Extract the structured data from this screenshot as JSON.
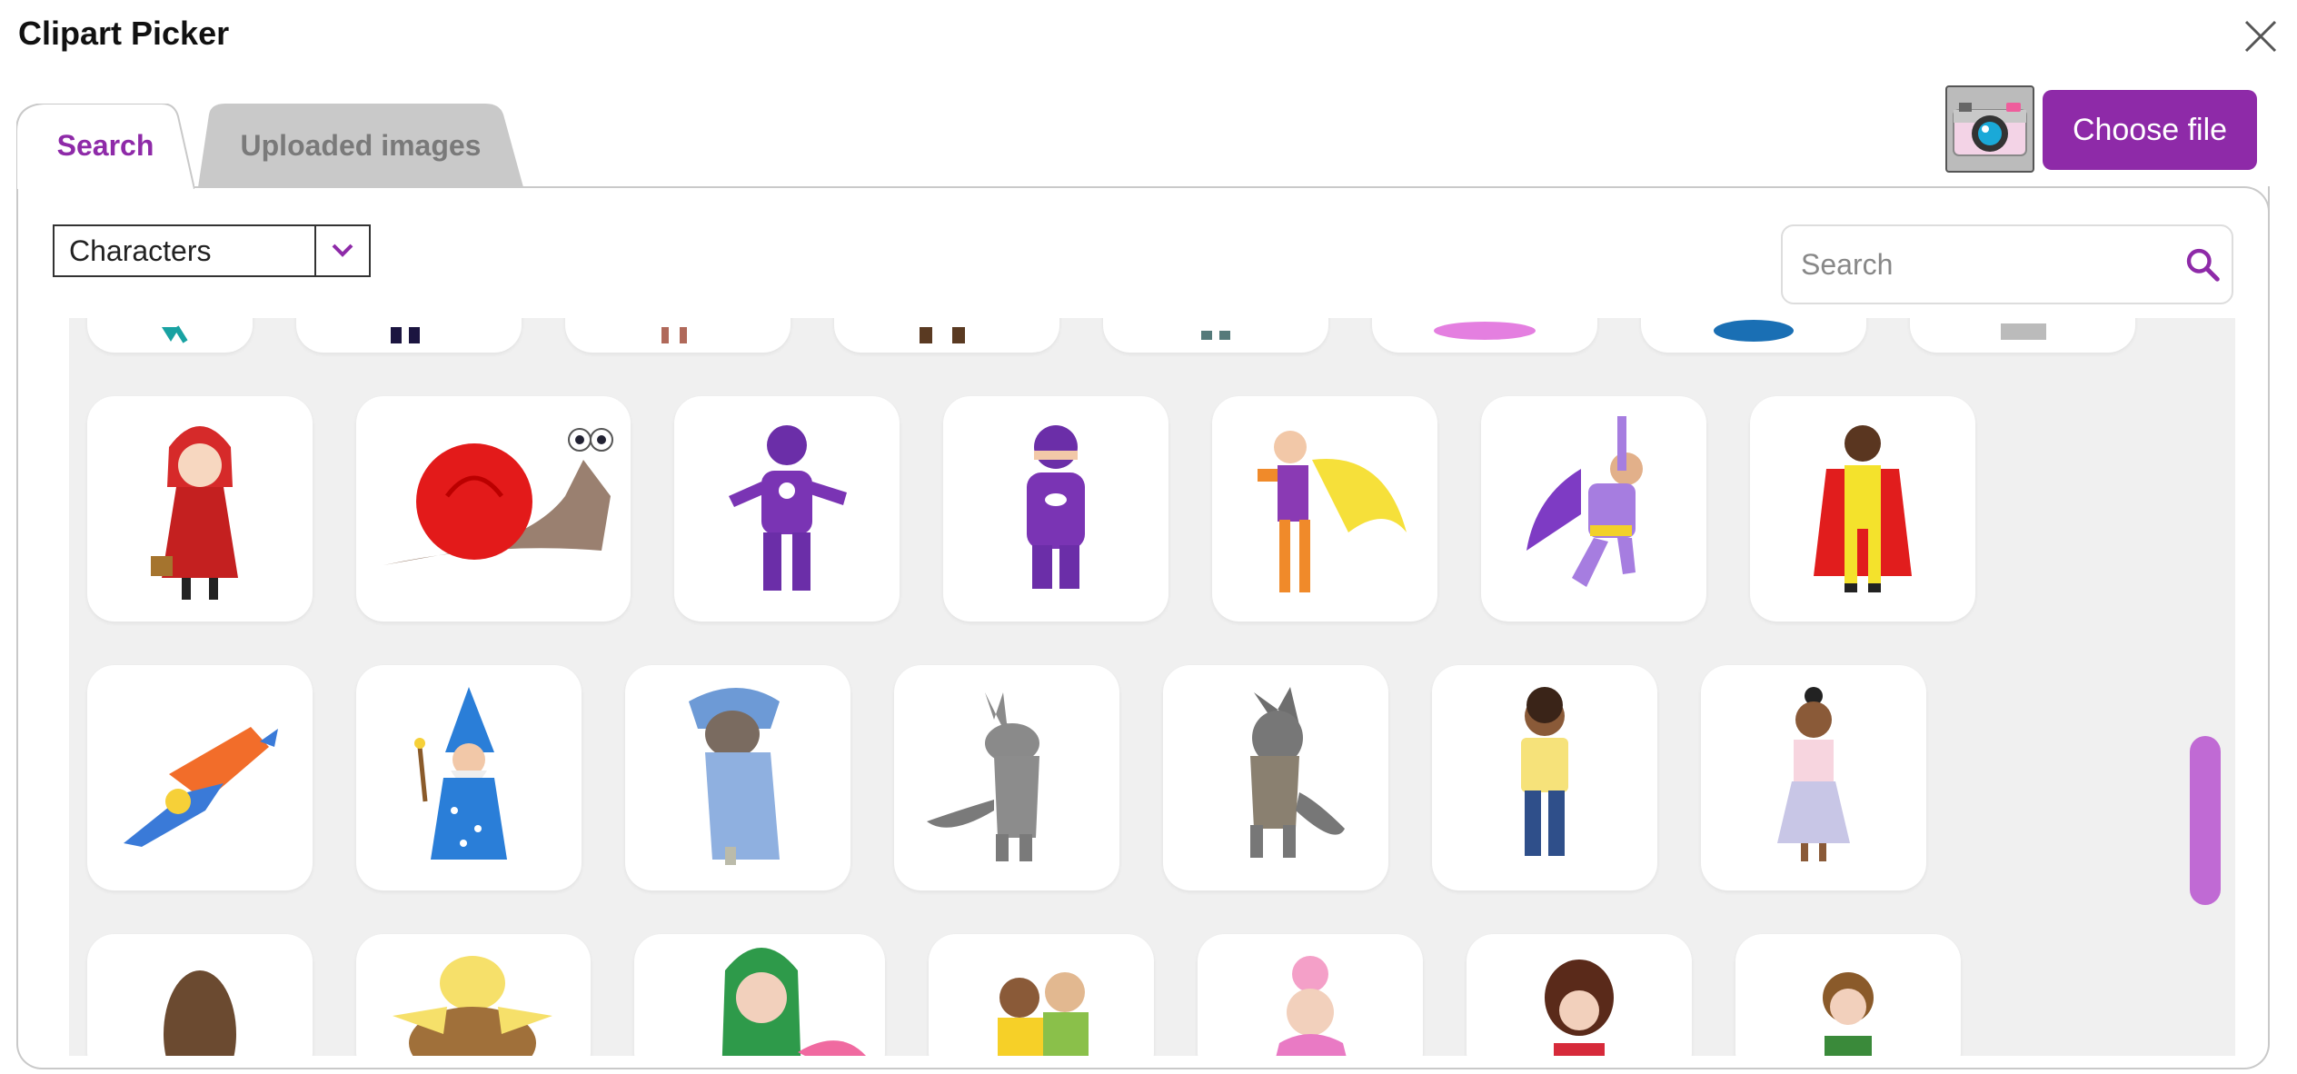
{
  "dialog": {
    "title": "Clipart Picker"
  },
  "upload": {
    "choose_file_label": "Choose file"
  },
  "tabs": [
    {
      "label": "Search",
      "active": true
    },
    {
      "label": "Uploaded images",
      "active": false
    }
  ],
  "category_select": {
    "selected": "Characters"
  },
  "search": {
    "placeholder": "Search",
    "value": ""
  },
  "colors": {
    "accent": "#8e2aa8",
    "scrollbar": "#c06ad4",
    "grid_bg": "#f0f0f0"
  },
  "clipart_rows": [
    {
      "row": "partial-top",
      "items": [
        "clipart-teal",
        "clipart-dark",
        "clipart-brown",
        "clipart-brown-boots",
        "clipart-grey",
        "clipart-pink",
        "clipart-blue",
        "clipart-light-grey"
      ]
    },
    {
      "row": 1,
      "items": [
        "red-riding-hood",
        "red-snail",
        "purple-robot",
        "purple-hooded-kid",
        "orange-yellow-superhero",
        "purple-flying-superhero",
        "red-caped-superhero"
      ]
    },
    {
      "row": 2,
      "items": [
        "flying-superhero",
        "blue-wizard",
        "wolf-in-nightgown",
        "grey-wolf-standing",
        "grey-wolf-walking",
        "boy-yellow-shirt",
        "girl-pink-top"
      ]
    },
    {
      "row": 3,
      "items": [
        "brown-creature",
        "turtle",
        "green-haired-mermaid",
        "two-friends",
        "grandma-pink-hat",
        "curly-haired-woman",
        "girl-with-book"
      ]
    }
  ]
}
